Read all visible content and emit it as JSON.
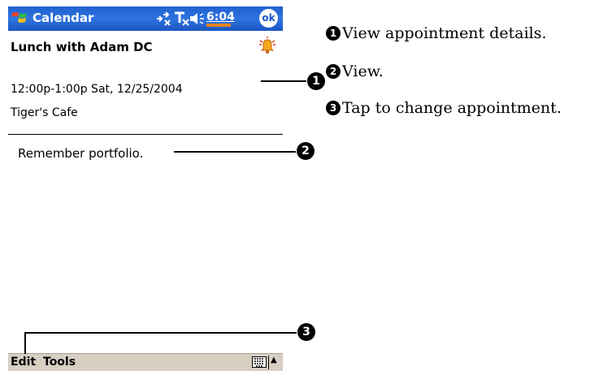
{
  "window": {
    "app_title": "Calendar",
    "clock": "6:04",
    "ok_label": "ok",
    "accent": "#2468d8"
  },
  "appointment": {
    "subject": "Lunch with Adam DC",
    "time": "12:00p-1:00p Sat, 12/25/2004",
    "location": "Tiger's Cafe",
    "notes": "Remember portfolio."
  },
  "menu_bar": {
    "edit_label": "Edit",
    "tools_label": "Tools"
  },
  "callouts": [
    {
      "marker": "1",
      "text": "View appointment details."
    },
    {
      "marker": "2",
      "text": "View."
    },
    {
      "marker": "3",
      "text": "Tap to change appointment."
    }
  ],
  "icons": [
    "windows-start-icon",
    "connectivity-icon",
    "signal-icon",
    "speaker-icon",
    "alarm-bell-icon",
    "keyboard-icon",
    "input-arrow-icon"
  ]
}
